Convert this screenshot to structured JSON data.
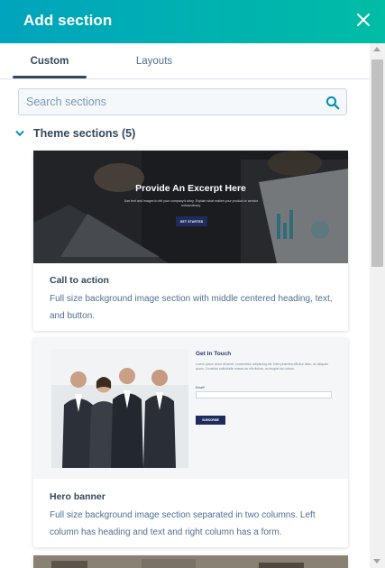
{
  "header": {
    "title": "Add section",
    "close_icon": "close-icon"
  },
  "tabs": [
    {
      "label": "Custom",
      "active": true
    },
    {
      "label": "Layouts",
      "active": false
    }
  ],
  "search": {
    "placeholder": "Search sections",
    "value": "",
    "icon": "search-icon"
  },
  "group": {
    "label": "Theme sections (5)",
    "expanded": true,
    "icon": "chevron-down-icon"
  },
  "cards": [
    {
      "title": "Call to action",
      "description": "Full size background image section with middle centered heading, text, and button.",
      "preview": {
        "heading": "Provide An Excerpt Here",
        "text": "Use text and images to tell your company's story. Explain what makes your product or service extraordinary.",
        "button": "GET STARTED"
      }
    },
    {
      "title": "Hero banner",
      "description": "Full size background image section separated in two columns. Left column has heading and text and right column has a form.",
      "preview": {
        "heading": "Get In Touch",
        "text": "Lorem ipsum dolor sit amet, consectetur adipiscing elit. Nam pharetra efficitur diam, ac aliquam quam. Curabitur sollicitudin massa ac elit dictum, ac feugiat dui rutrum.",
        "field_label": "Email*",
        "button": "SUBSCRIBE"
      }
    }
  ],
  "colors": {
    "header_start": "#00a4bd",
    "header_end": "#00bda5",
    "text_primary": "#33475b",
    "accent": "#0091ae"
  }
}
